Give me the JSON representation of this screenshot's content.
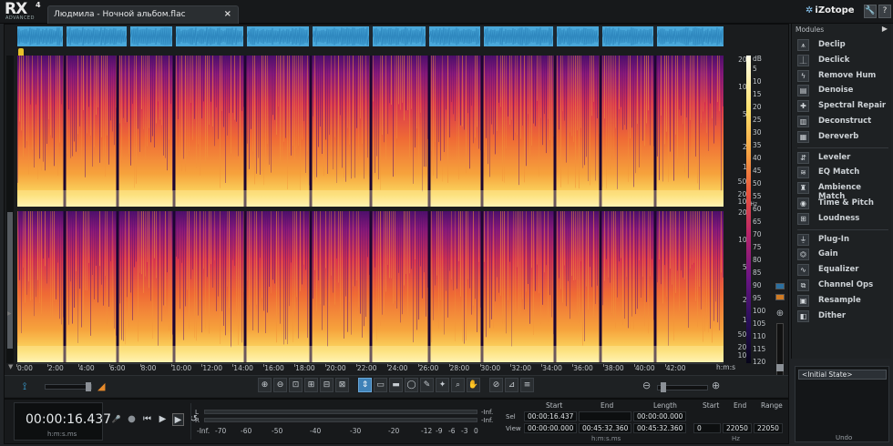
{
  "app": {
    "logo_text": "RX",
    "logo_superscript": "4",
    "logo_edition": "ADVANCED",
    "brand": "iZotope",
    "brand_star": "✲"
  },
  "tab": {
    "title": "Людмила - Ночной альбом.flac",
    "close_symbol": "×"
  },
  "window_buttons": {
    "settings": "🔧",
    "help": "?"
  },
  "frequency_axis": {
    "channel_1": [
      "20k",
      "10k",
      "5k",
      "2k",
      "1k",
      "500",
      "200",
      "100"
    ],
    "channel_2": [
      "20k",
      "10k",
      "5k",
      "2k",
      "1k",
      "500",
      "200",
      "100"
    ],
    "unit": "Hz"
  },
  "db_axis": {
    "unit": "dB",
    "ticks": [
      "5",
      "10",
      "15",
      "20",
      "25",
      "30",
      "35",
      "40",
      "45",
      "50",
      "55",
      "60",
      "65",
      "70",
      "75",
      "80",
      "85",
      "90",
      "95",
      "100",
      "105",
      "110",
      "115",
      "120"
    ]
  },
  "time_axis": {
    "ticks": [
      "0:00",
      "2:00",
      "4:00",
      "6:00",
      "8:00",
      "10:00",
      "12:00",
      "14:00",
      "16:00",
      "18:00",
      "20:00",
      "22:00",
      "24:00",
      "26:00",
      "28:00",
      "30:00",
      "32:00",
      "34:00",
      "36:00",
      "38:00",
      "40:00",
      "42:00"
    ],
    "unit": "h:m:s"
  },
  "tools": {
    "zoom": [
      "⊕",
      "⊖",
      "⊡",
      "⊞",
      "⊟",
      "⊠"
    ],
    "selection": [
      "⇕",
      "▭",
      "▬",
      "◯",
      "✎",
      "✦",
      "⌕",
      "✋"
    ],
    "other": [
      "⊘",
      "⊿",
      "≡"
    ]
  },
  "transport": {
    "timecode": "00:00:16.437",
    "timecode_unit": "h:m:s.ms",
    "buttons": [
      "🎤",
      "●",
      "⏮",
      "▶",
      "▶",
      "↺"
    ]
  },
  "meter": {
    "left_label": "L",
    "right_label": "R",
    "left_peak": "-Inf.",
    "right_peak": "-Inf.",
    "scale": [
      "-Inf.",
      "-70",
      "-60",
      "-50",
      "-40",
      "-30",
      "-20",
      "-12",
      "-9",
      "-6",
      "-3",
      "0"
    ]
  },
  "selection_info": {
    "headers": {
      "start": "Start",
      "end": "End",
      "length": "Length",
      "low": "Start",
      "high": "End",
      "range": "Range"
    },
    "sel_label": "Sel",
    "view_label": "View",
    "sel": {
      "start": "00:00:16.437",
      "end": "",
      "length": "00:00:00.000"
    },
    "view": {
      "start": "00:00:00.000",
      "end": "00:45:32.360",
      "length": "00:45:32.360"
    },
    "freq": {
      "low": "0",
      "high": "22050",
      "range": "22050"
    },
    "time_unit": "h:m:s.ms",
    "freq_unit": "Hz"
  },
  "modules": {
    "header": "Modules",
    "group1": [
      {
        "label": "Declip",
        "icon": "declip-icon",
        "glyph": "⩚"
      },
      {
        "label": "Declick",
        "icon": "declick-icon",
        "glyph": "⏊"
      },
      {
        "label": "Remove Hum",
        "icon": "hum-icon",
        "glyph": "ϟ"
      },
      {
        "label": "Denoise",
        "icon": "denoise-icon",
        "glyph": "▤"
      },
      {
        "label": "Spectral Repair",
        "icon": "spectral-repair-icon",
        "glyph": "✚"
      },
      {
        "label": "Deconstruct",
        "icon": "deconstruct-icon",
        "glyph": "▥"
      },
      {
        "label": "Dereverb",
        "icon": "dereverb-icon",
        "glyph": "▦"
      }
    ],
    "group2": [
      {
        "label": "Leveler",
        "icon": "leveler-icon",
        "glyph": "⇵"
      },
      {
        "label": "EQ Match",
        "icon": "eq-match-icon",
        "glyph": "≋"
      },
      {
        "label": "Ambience Match",
        "icon": "ambience-icon",
        "glyph": "♜"
      },
      {
        "label": "Time & Pitch",
        "icon": "time-pitch-icon",
        "glyph": "◉"
      },
      {
        "label": "Loudness",
        "icon": "loudness-icon",
        "glyph": "⊞"
      }
    ],
    "group3": [
      {
        "label": "Plug-In",
        "icon": "plugin-icon",
        "glyph": "⏚"
      },
      {
        "label": "Gain",
        "icon": "gain-icon",
        "glyph": "⏣"
      },
      {
        "label": "Equalizer",
        "icon": "equalizer-icon",
        "glyph": "∿"
      },
      {
        "label": "Channel Ops",
        "icon": "channel-ops-icon",
        "glyph": "⧉"
      },
      {
        "label": "Resample",
        "icon": "resample-icon",
        "glyph": "▣"
      },
      {
        "label": "Dither",
        "icon": "dither-icon",
        "glyph": "◧"
      }
    ]
  },
  "undo": {
    "item": "<Initial State>",
    "label": "Undo"
  },
  "colors": {
    "waveform": "#4aa8da",
    "spectrogram_high": "#fce06a",
    "spectrogram_low": "#3a0b5e",
    "active_tool": "#3f82b8"
  }
}
